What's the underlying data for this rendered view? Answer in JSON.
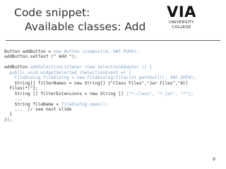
{
  "title": {
    "line1": "Code snippet:",
    "line2": "Available classes: Add"
  },
  "logo": {
    "main": "VIA",
    "sub": "UNIVERSITY COLLEGE"
  },
  "code": [
    [
      {
        "t": "Button addButton = "
      },
      {
        "t": "new Button (composite, SWT.PUSH);",
        "kw": true
      }
    ],
    [
      {
        "t": "addButton.setText (\" Add \");"
      }
    ],
    [],
    [
      {
        "t": "addButton."
      },
      {
        "t": "addSelectionListener (new SelectionAdapter () {",
        "kw": true
      }
    ],
    [
      {
        "t": "  public void widgetSelected (SelectionEvent e) {",
        "kw": true
      }
    ],
    [
      {
        "t": "    FileDialog fileDialog = new FileDialog(fileList.getShell(), SWT.OPEN);",
        "kw": true
      }
    ],
    [
      {
        "t": "    String[] filterNames = new String[] {\"Class Files\",\"Jar Files\",\"All"
      }
    ],
    [
      {
        "t": "  Files(*)\"};"
      }
    ],
    [
      {
        "t": "    String [] filterExtensions = new String [] "
      },
      {
        "t": "{\"*.class\", \"*.jar\", \"*\"};",
        "kw": true
      }
    ],
    [
      {
        "t": "    ..."
      }
    ],
    [
      {
        "t": "    String fileName = "
      },
      {
        "t": "fileDialog.open();",
        "kw": true
      }
    ],
    [
      {
        "t": "    ...  // see next slide"
      }
    ],
    [
      {
        "t": "  }"
      }
    ],
    [
      {
        "t": "});"
      }
    ]
  ],
  "slide_number": "9",
  "colors": {
    "keyword": "#7aa2c8",
    "text": "#333333",
    "rule": "#6b6b6b"
  }
}
